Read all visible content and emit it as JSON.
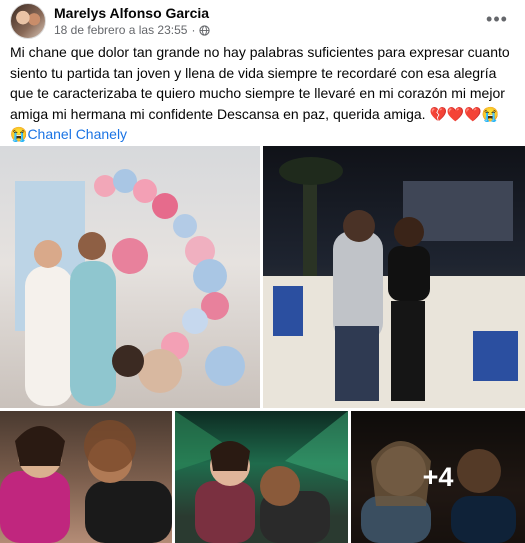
{
  "post": {
    "author": "Marelys Alfonso Garcia",
    "timestamp": "18 de febrero a las 23:55",
    "separator": "·",
    "privacy_icon": "globe-icon",
    "more_label": "•••",
    "text_main": "Mi chane que dolor tan grande no hay palabras suficientes para expresar cuanto siento tu partida tan joven y llena de vida siempre te recordaré con esa alegría que te caracterizaba  te quiero mucho siempre te llevaré en mi corazón  mi mejor amiga mi hermana mi confidente Descansa en paz, querida amiga. ",
    "text_emoji_hearts": "💔❤️❤️",
    "text_emoji_faces": "😭😭",
    "mention": "Chanel Chanely"
  },
  "photos": {
    "more_count": "+4"
  },
  "colors": {
    "mention": "#1b74e4",
    "meta": "#65676b",
    "text": "#050505"
  }
}
